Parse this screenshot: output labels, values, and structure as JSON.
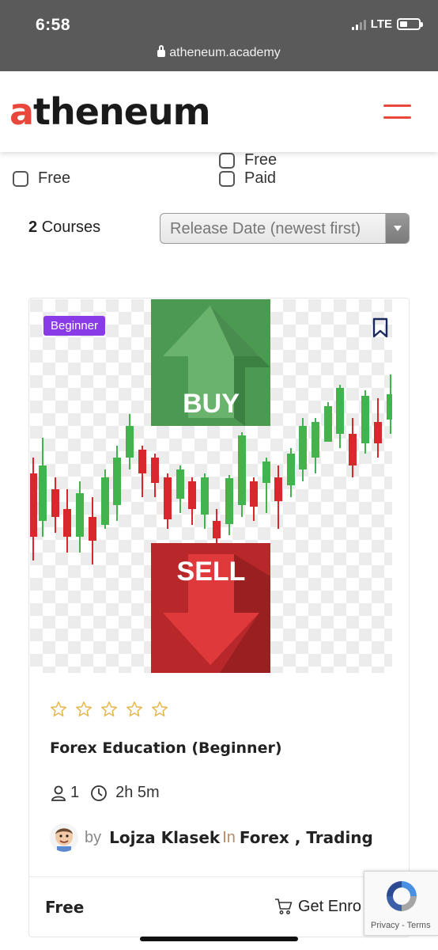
{
  "status_bar": {
    "time": "6:58",
    "network": "LTE",
    "url": "atheneum.academy"
  },
  "header": {
    "logo_prefix": "a",
    "logo_rest": "theneum"
  },
  "filters": {
    "left": [
      {
        "label": "Free"
      }
    ],
    "right": [
      {
        "label": "Free"
      },
      {
        "label": "Paid"
      }
    ]
  },
  "results": {
    "count": "2",
    "count_label": "Courses"
  },
  "sort": {
    "selected": "Release Date (newest first)"
  },
  "course": {
    "level_badge": "Beginner",
    "thumbnail_buy": "BUY",
    "thumbnail_sell": "SELL",
    "rating": 0,
    "rating_max": 5,
    "title": "Forex Education (Beginner)",
    "students": "1",
    "duration": "2h 5m",
    "by": "by",
    "author": "Lojza Klasek",
    "in": "In",
    "categories": "Forex ,  Trading",
    "price": "Free",
    "cta": "Get Enro"
  },
  "recaptcha": {
    "links": "Privacy - Terms"
  },
  "colors": {
    "brand_accent": "#e9473b",
    "badge_purple": "#8a3be8",
    "star_gold": "#e8b64a",
    "buy_green": "#4c9a52",
    "sell_red": "#b8282a"
  }
}
